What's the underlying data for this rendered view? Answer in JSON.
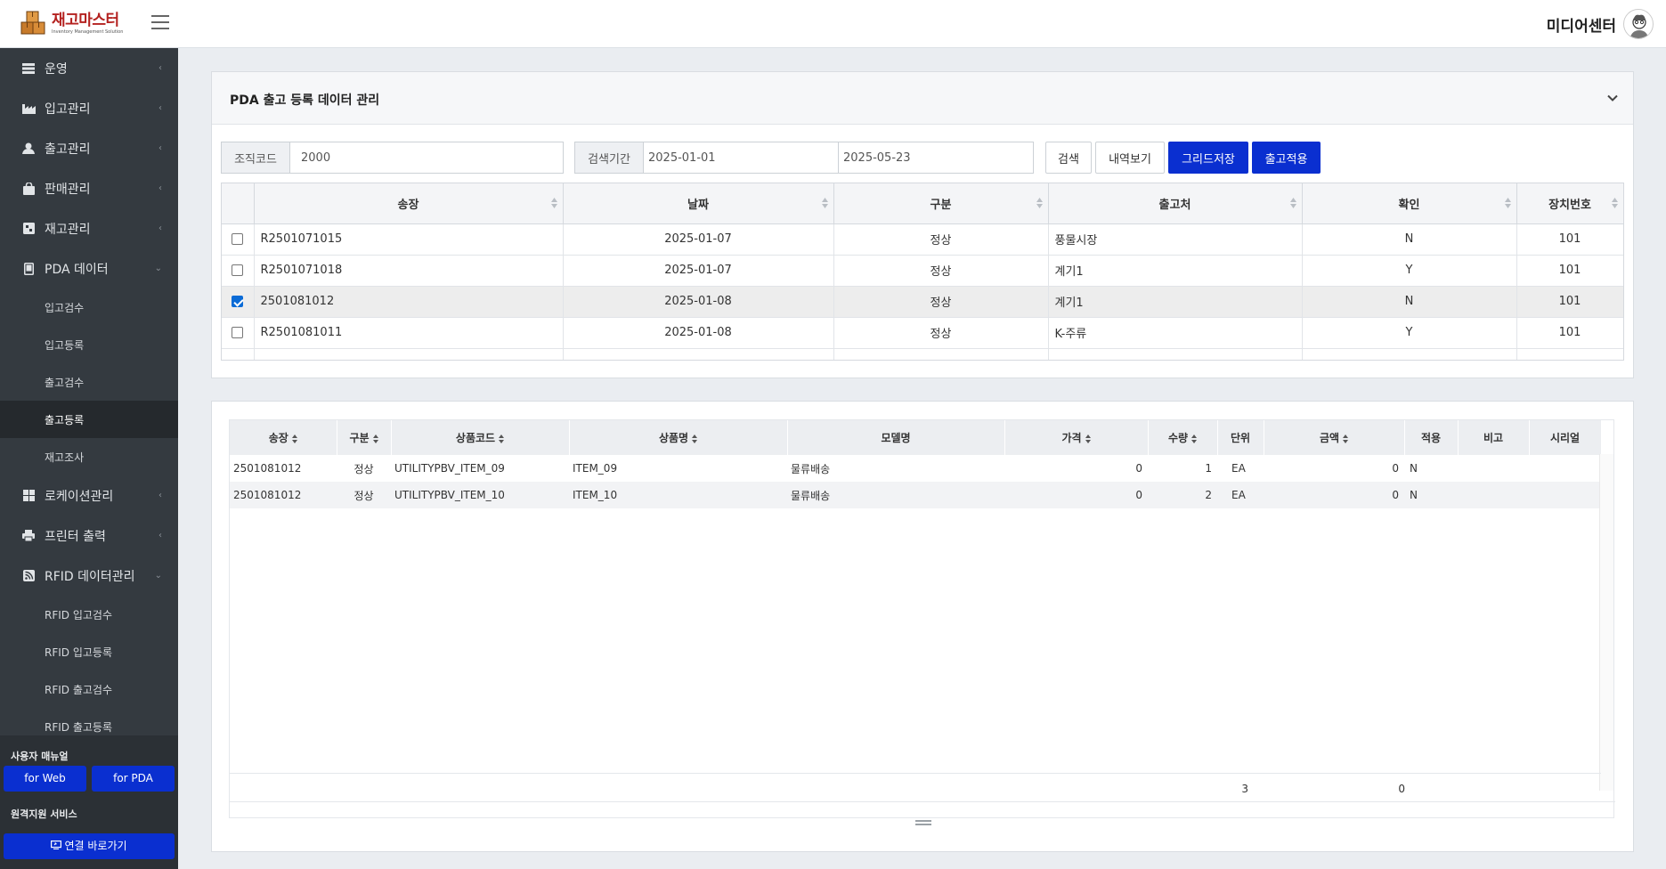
{
  "header": {
    "logo_title": "재고마스터",
    "logo_subtitle": "Inventory Management Solution",
    "user_name": "미디어센터"
  },
  "sidebar": {
    "items": [
      {
        "label": "운영",
        "icon": "table-icon",
        "expanded": false
      },
      {
        "label": "입고관리",
        "icon": "industry-icon",
        "expanded": false
      },
      {
        "label": "출고관리",
        "icon": "truck-icon",
        "expanded": false
      },
      {
        "label": "판매관리",
        "icon": "shopping-bag-icon",
        "expanded": false
      },
      {
        "label": "재고관리",
        "icon": "box-icon",
        "expanded": false
      },
      {
        "label": "PDA 데이터",
        "icon": "tablet-icon",
        "expanded": true
      },
      {
        "label": "로케이션관리",
        "icon": "grid-icon",
        "expanded": false
      },
      {
        "label": "프린터 출력",
        "icon": "printer-icon",
        "expanded": false
      },
      {
        "label": "RFID 데이터관리",
        "icon": "rss-icon",
        "expanded": true
      }
    ],
    "pda_sub": [
      "입고검수",
      "입고등록",
      "출고검수",
      "출고등록",
      "재고조사"
    ],
    "rfid_sub": [
      "RFID 입고검수",
      "RFID 입고등록",
      "RFID 출고검수",
      "RFID 출고등록"
    ],
    "active_sub": "출고등록",
    "manual_title": "사용자 매뉴얼",
    "manual_web": "for Web",
    "manual_pda": "for PDA",
    "remote_title": "원격지원 서비스",
    "remote_button": "연결 바로가기"
  },
  "panel1": {
    "title": "PDA 출고 등록 데이터 관리",
    "org_label": "조직코드",
    "org_value": "2000",
    "period_label": "검색기간",
    "date_from": "2025-01-01",
    "date_to": "2025-05-23",
    "btn_search": "검색",
    "btn_history": "내역보기",
    "btn_grid_save": "그리드저장",
    "btn_apply": "출고적용",
    "columns": [
      "송장",
      "날짜",
      "구분",
      "출고처",
      "확인",
      "장치번호"
    ],
    "rows": [
      {
        "checked": false,
        "invoice": "R2501071015",
        "date": "2025-01-07",
        "type": "정상",
        "dest": "풍물시장",
        "confirm": "N",
        "device": "101"
      },
      {
        "checked": false,
        "invoice": "R2501071018",
        "date": "2025-01-07",
        "type": "정상",
        "dest": "계기1",
        "confirm": "Y",
        "device": "101"
      },
      {
        "checked": true,
        "invoice": "2501081012",
        "date": "2025-01-08",
        "type": "정상",
        "dest": "계기1",
        "confirm": "N",
        "device": "101"
      },
      {
        "checked": false,
        "invoice": "R2501081011",
        "date": "2025-01-08",
        "type": "정상",
        "dest": "K-주류",
        "confirm": "Y",
        "device": "101"
      }
    ]
  },
  "panel2": {
    "columns": [
      "송장",
      "구분",
      "상품코드",
      "상품명",
      "모델명",
      "가격",
      "수량",
      "단위",
      "금액",
      "적용",
      "비고",
      "시리얼"
    ],
    "rows": [
      {
        "invoice": "2501081012",
        "type": "정상",
        "code": "UTILITYPBV_ITEM_09",
        "name": "ITEM_09",
        "model": "물류배송",
        "price": "0",
        "qty": "1",
        "unit": "EA",
        "amount": "0",
        "applied": "N",
        "note": "",
        "serial": ""
      },
      {
        "invoice": "2501081012",
        "type": "정상",
        "code": "UTILITYPBV_ITEM_10",
        "name": "ITEM_10",
        "model": "물류배송",
        "price": "0",
        "qty": "2",
        "unit": "EA",
        "amount": "0",
        "applied": "N",
        "note": "",
        "serial": ""
      }
    ],
    "total_qty": "3",
    "total_amount": "0"
  }
}
